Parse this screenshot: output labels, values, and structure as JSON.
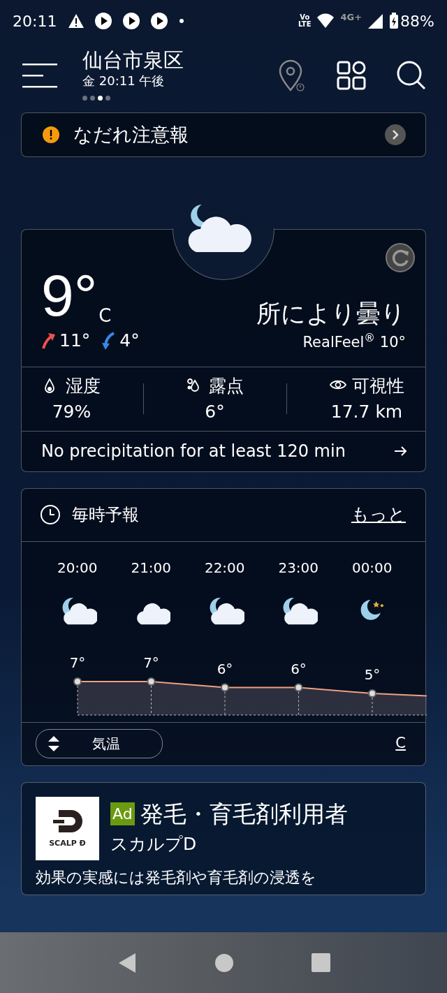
{
  "status_bar": {
    "time": "20:11",
    "volte": [
      "Vo",
      "LTE"
    ],
    "network": "4G+",
    "battery": "88%"
  },
  "header": {
    "location": "仙台市泉区",
    "datetime": "金 20:11 午後",
    "pages": [
      {
        "selected": false
      },
      {
        "selected": false
      },
      {
        "selected": true
      },
      {
        "selected": false
      }
    ]
  },
  "alert": {
    "text": "なだれ注意報"
  },
  "current": {
    "temp": "9°",
    "unit": "C",
    "high": "11°",
    "low": "4°",
    "condition": "所により曇り",
    "realfeel": "RealFeel$^{®}$ 10°",
    "details": [
      {
        "kind": "humidity",
        "label": "湿度",
        "value": "79%"
      },
      {
        "kind": "dewpoint",
        "label": "露点",
        "value": "6°"
      },
      {
        "kind": "visibility",
        "label": "可視性",
        "value": "17.7 km"
      }
    ],
    "precipitation": "No precipitation for at least 120 min"
  },
  "hourly": {
    "title": "毎時予報",
    "more": "もっと",
    "hours": [
      {
        "time": "20:00",
        "kind": "partly-cloudy-night",
        "temp": "7°"
      },
      {
        "time": "21:00",
        "kind": "cloudy",
        "temp": "7°"
      },
      {
        "time": "22:00",
        "kind": "partly-cloudy-night",
        "temp": "6°"
      },
      {
        "time": "23:00",
        "kind": "partly-cloudy-night",
        "temp": "6°"
      },
      {
        "time": "00:00",
        "kind": "clear-night",
        "temp": "5°"
      }
    ],
    "selector": "気温",
    "unit": "C"
  },
  "ad": {
    "badge": "Ad",
    "logo": "SCALP Ð",
    "title": "発毛・育毛剤利用者",
    "advertiser": "スカルプD",
    "body": "効果の実感には発毛剤や育毛剤の浸透を"
  }
}
